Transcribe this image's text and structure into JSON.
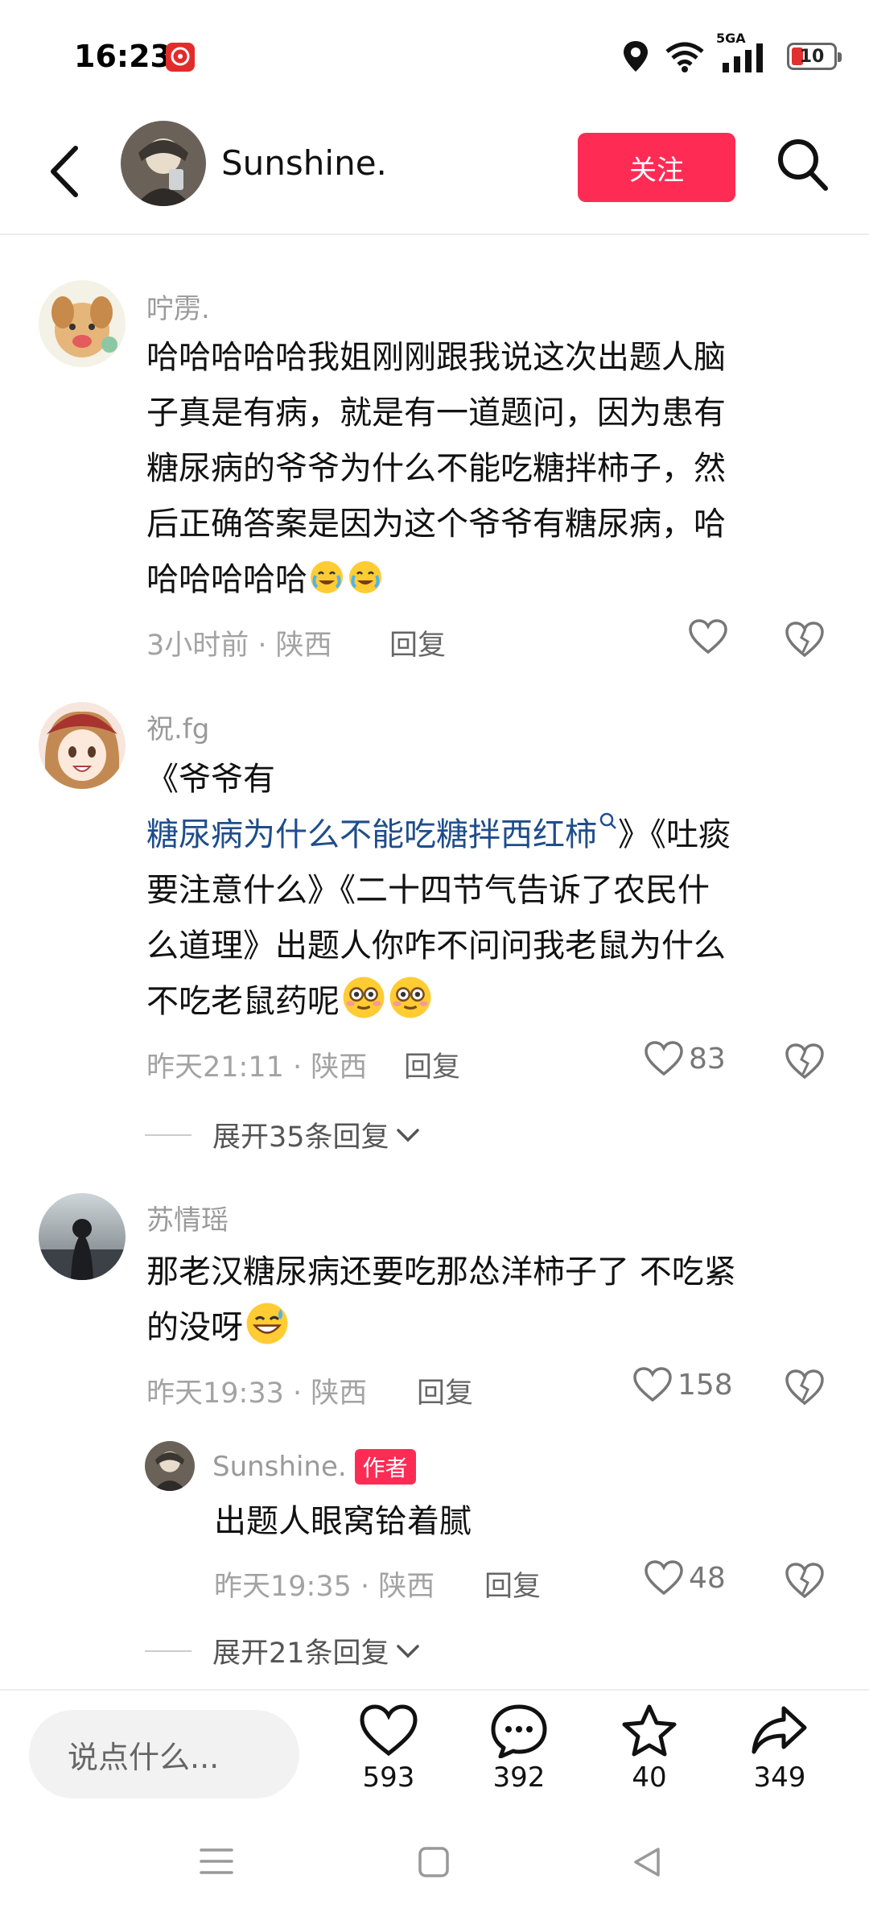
{
  "status_bar": {
    "time": "16:23",
    "network": "5GA",
    "battery": "10"
  },
  "header": {
    "username": "Sunshine.",
    "follow_label": "关注"
  },
  "comments": [
    {
      "nickname": "咛雳.",
      "text_lines": [
        "哈哈哈哈哈我姐刚刚跟我说这次出题人脑",
        "子真是有病，就是有一道题问，因为患有",
        "糖尿病的爷爷为什么不能吃糖拌柿子，然",
        "后正确答案是因为这个爷爷有糖尿病，哈",
        "哈哈哈哈哈"
      ],
      "time_location": "3小时前 · 陕西",
      "reply_label": "回复",
      "likes": ""
    },
    {
      "nickname": "祝.fg",
      "line1": "《爷爷有",
      "link": "糖尿病为什么不能吃糖拌西红柿",
      "line2_tail": "》《吐痰",
      "text_lines": [
        "要注意什么》《二十四节气告诉了农民什",
        "么道理》出题人你咋不问问我老鼠为什么",
        "不吃老鼠药呢"
      ],
      "time_location": "昨天21:11 · 陕西",
      "reply_label": "回复",
      "likes": "83",
      "expand": "展开35条回复"
    },
    {
      "nickname": "苏情瑶",
      "text_lines": [
        "那老汉糖尿病还要吃那怂洋柿子了 不吃紧",
        "的没呀"
      ],
      "time_location": "昨天19:33 · 陕西",
      "reply_label": "回复",
      "likes": "158",
      "expand": "展开21条回复"
    }
  ],
  "sub_reply": {
    "nickname": "Sunshine.",
    "badge": "作者",
    "text": "出题人眼窝铪着腻",
    "time_location": "昨天19:35 · 陕西",
    "reply_label": "回复",
    "likes": "48"
  },
  "bottom_bar": {
    "placeholder": "说点什么...",
    "likes": "593",
    "comments": "392",
    "favorites": "40",
    "shares": "349"
  },
  "colors": {
    "accent": "#fe2c55",
    "link": "#1f4d8c"
  }
}
